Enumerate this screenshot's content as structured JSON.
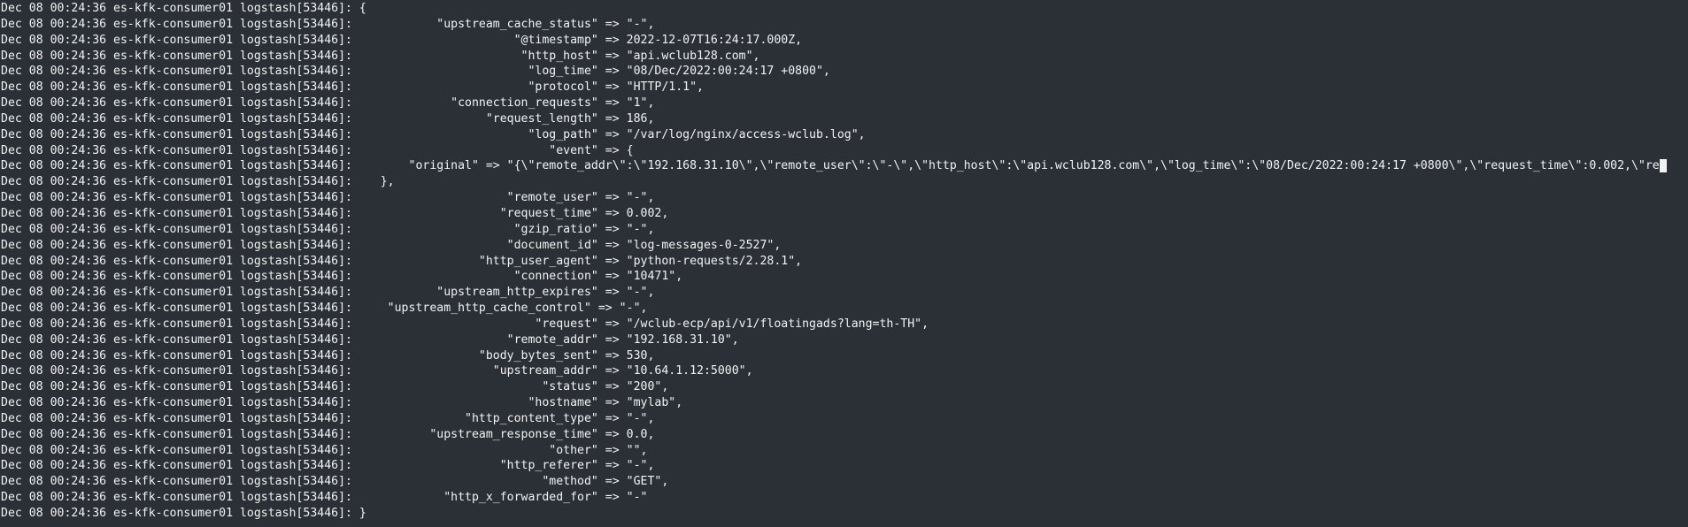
{
  "terminal": {
    "background": "#2b3036",
    "foreground": "#f2f2f2",
    "lines": [
      {
        "prefix": "Dec 08 00:24:36 es-kfk-consumer01 logstash[53446]:",
        "text": " {"
      },
      {
        "prefix": "Dec 08 00:24:36 es-kfk-consumer01 logstash[53446]:",
        "text": "            \"upstream_cache_status\" => \"-\","
      },
      {
        "prefix": "Dec 08 00:24:36 es-kfk-consumer01 logstash[53446]:",
        "text": "                       \"@timestamp\" => 2022-12-07T16:24:17.000Z,"
      },
      {
        "prefix": "Dec 08 00:24:36 es-kfk-consumer01 logstash[53446]:",
        "text": "                        \"http_host\" => \"api.wclub128.com\","
      },
      {
        "prefix": "Dec 08 00:24:36 es-kfk-consumer01 logstash[53446]:",
        "text": "                         \"log_time\" => \"08/Dec/2022:00:24:17 +0800\","
      },
      {
        "prefix": "Dec 08 00:24:36 es-kfk-consumer01 logstash[53446]:",
        "text": "                         \"protocol\" => \"HTTP/1.1\","
      },
      {
        "prefix": "Dec 08 00:24:36 es-kfk-consumer01 logstash[53446]:",
        "text": "              \"connection_requests\" => \"1\","
      },
      {
        "prefix": "Dec 08 00:24:36 es-kfk-consumer01 logstash[53446]:",
        "text": "                   \"request_length\" => 186,"
      },
      {
        "prefix": "Dec 08 00:24:36 es-kfk-consumer01 logstash[53446]:",
        "text": "                         \"log_path\" => \"/var/log/nginx/access-wclub.log\","
      },
      {
        "prefix": "Dec 08 00:24:36 es-kfk-consumer01 logstash[53446]:",
        "text": "                            \"event\" => {"
      },
      {
        "prefix": "Dec 08 00:24:36 es-kfk-consumer01 logstash[53446]:",
        "text": "        \"original\" => \"{\\\"remote_addr\\\":\\\"192.168.31.10\\\",\\\"remote_user\\\":\\\"-\\\",\\\"http_host\\\":\\\"api.wclub128.com\\\",\\\"log_time\\\":\\\"08/Dec/2022:00:24:17 +0800\\\",\\\"request_time\\\":0.002,\\\"re",
        "cursor": true
      },
      {
        "prefix": "Dec 08 00:24:36 es-kfk-consumer01 logstash[53446]:",
        "text": "    },"
      },
      {
        "prefix": "Dec 08 00:24:36 es-kfk-consumer01 logstash[53446]:",
        "text": "                      \"remote_user\" => \"-\","
      },
      {
        "prefix": "Dec 08 00:24:36 es-kfk-consumer01 logstash[53446]:",
        "text": "                     \"request_time\" => 0.002,"
      },
      {
        "prefix": "Dec 08 00:24:36 es-kfk-consumer01 logstash[53446]:",
        "text": "                       \"gzip_ratio\" => \"-\","
      },
      {
        "prefix": "Dec 08 00:24:36 es-kfk-consumer01 logstash[53446]:",
        "text": "                      \"document_id\" => \"log-messages-0-2527\","
      },
      {
        "prefix": "Dec 08 00:24:36 es-kfk-consumer01 logstash[53446]:",
        "text": "                  \"http_user_agent\" => \"python-requests/2.28.1\","
      },
      {
        "prefix": "Dec 08 00:24:36 es-kfk-consumer01 logstash[53446]:",
        "text": "                       \"connection\" => \"10471\","
      },
      {
        "prefix": "Dec 08 00:24:36 es-kfk-consumer01 logstash[53446]:",
        "text": "            \"upstream_http_expires\" => \"-\","
      },
      {
        "prefix": "Dec 08 00:24:36 es-kfk-consumer01 logstash[53446]:",
        "text": "     \"upstream_http_cache_control\" => \"-\","
      },
      {
        "prefix": "Dec 08 00:24:36 es-kfk-consumer01 logstash[53446]:",
        "text": "                          \"request\" => \"/wclub-ecp/api/v1/floatingads?lang=th-TH\","
      },
      {
        "prefix": "Dec 08 00:24:36 es-kfk-consumer01 logstash[53446]:",
        "text": "                      \"remote_addr\" => \"192.168.31.10\","
      },
      {
        "prefix": "Dec 08 00:24:36 es-kfk-consumer01 logstash[53446]:",
        "text": "                  \"body_bytes_sent\" => 530,"
      },
      {
        "prefix": "Dec 08 00:24:36 es-kfk-consumer01 logstash[53446]:",
        "text": "                    \"upstream_addr\" => \"10.64.1.12:5000\","
      },
      {
        "prefix": "Dec 08 00:24:36 es-kfk-consumer01 logstash[53446]:",
        "text": "                           \"status\" => \"200\","
      },
      {
        "prefix": "Dec 08 00:24:36 es-kfk-consumer01 logstash[53446]:",
        "text": "                         \"hostname\" => \"mylab\","
      },
      {
        "prefix": "Dec 08 00:24:36 es-kfk-consumer01 logstash[53446]:",
        "text": "                \"http_content_type\" => \"-\","
      },
      {
        "prefix": "Dec 08 00:24:36 es-kfk-consumer01 logstash[53446]:",
        "text": "           \"upstream_response_time\" => 0.0,"
      },
      {
        "prefix": "Dec 08 00:24:36 es-kfk-consumer01 logstash[53446]:",
        "text": "                            \"other\" => \"\","
      },
      {
        "prefix": "Dec 08 00:24:36 es-kfk-consumer01 logstash[53446]:",
        "text": "                     \"http_referer\" => \"-\","
      },
      {
        "prefix": "Dec 08 00:24:36 es-kfk-consumer01 logstash[53446]:",
        "text": "                           \"method\" => \"GET\","
      },
      {
        "prefix": "Dec 08 00:24:36 es-kfk-consumer01 logstash[53446]:",
        "text": "             \"http_x_forwarded_for\" => \"-\""
      },
      {
        "prefix": "Dec 08 00:24:36 es-kfk-consumer01 logstash[53446]:",
        "text": " }"
      }
    ]
  }
}
